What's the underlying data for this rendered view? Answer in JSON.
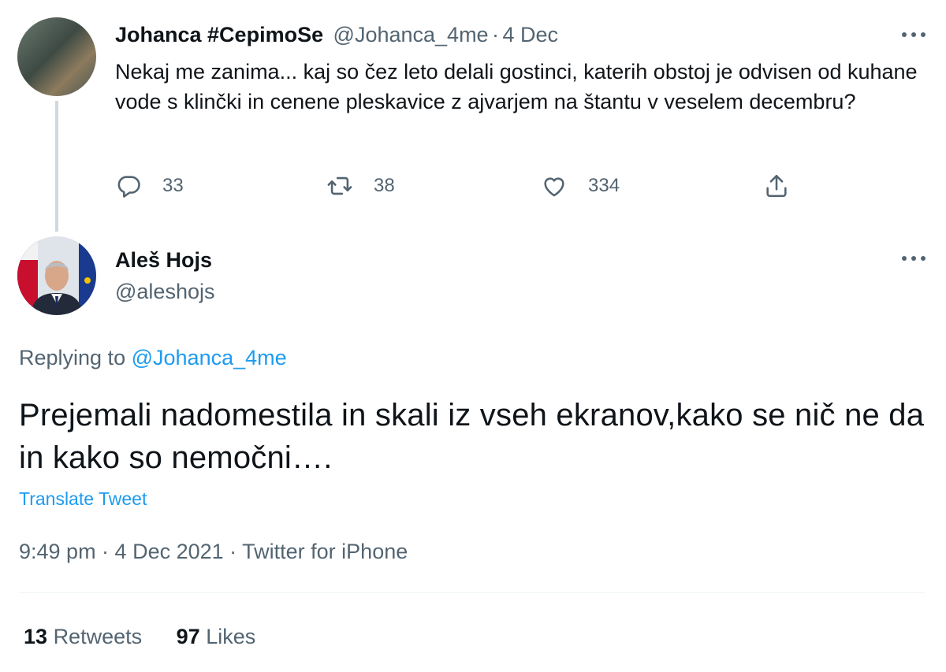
{
  "parent_tweet": {
    "author_name": "Johanca #CepimoSe",
    "author_handle": "@Johanca_4me",
    "separator": "·",
    "date": "4 Dec",
    "text": "Nekaj me zanima... kaj so čez leto delali gostinci, katerih obstoj je odvisen od kuhane vode s klinčki in cenene pleskavice z ajvarjem na štantu v veselem decembru?",
    "reply_count": "33",
    "retweet_count": "38",
    "like_count": "334",
    "icons": [
      "reply-icon",
      "retweet-icon",
      "like-icon",
      "share-icon",
      "more-icon"
    ]
  },
  "main_tweet": {
    "author_name": "Aleš Hojs",
    "author_handle": "@aleshojs",
    "replying_prefix": "Replying to",
    "replying_to": "@Johanca_4me",
    "text": "Prejemali nadomestila in skali iz vseh ekranov,kako se nič ne da in kako so nemočni….",
    "translate_label": "Translate Tweet",
    "timestamp": "9:49 pm · 4 Dec 2021 · Twitter for iPhone",
    "retweets_count": "13",
    "retweets_label": "Retweets",
    "likes_count": "97",
    "likes_label": "Likes"
  },
  "colors": {
    "accent": "#1d9bf0",
    "secondary_text": "#536471",
    "primary_text": "#0f1419",
    "thread_line": "#cfd9de"
  }
}
